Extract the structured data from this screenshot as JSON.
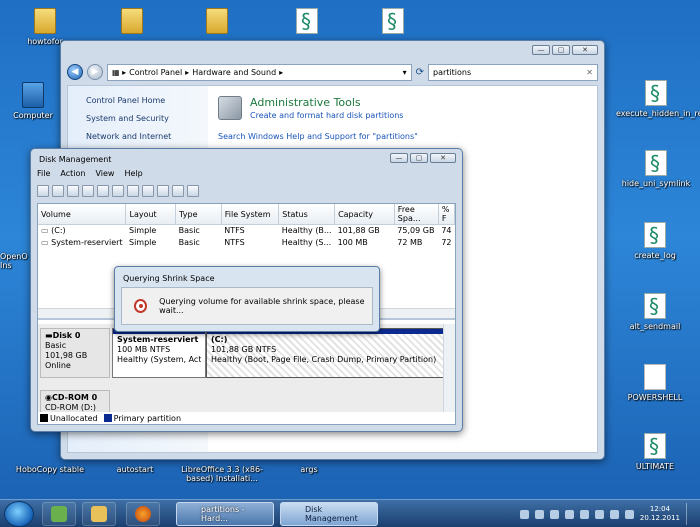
{
  "desktop": {
    "icons": [
      {
        "label": "howtofor",
        "type": "folder"
      },
      {
        "label": "",
        "type": "folder"
      },
      {
        "label": "",
        "type": "folder"
      },
      {
        "label": "",
        "type": "script"
      },
      {
        "label": "",
        "type": "script"
      },
      {
        "label": "Computer",
        "type": "computer"
      },
      {
        "label": "execute_hidden_in_reg",
        "type": "script"
      },
      {
        "label": "hide_uni_symlink",
        "type": "script"
      },
      {
        "label": "create_log",
        "type": "script"
      },
      {
        "label": "alt_sendmail",
        "type": "script"
      },
      {
        "label": "POWERSHELL",
        "type": "doc"
      },
      {
        "label": "ULTIMATE",
        "type": "script"
      },
      {
        "label": "HoboCopy stable",
        "type": "app"
      },
      {
        "label": "autostart",
        "type": "app"
      },
      {
        "label": "LibreOffice 3.3 (x86-based) Installati...",
        "type": "app"
      },
      {
        "label": "args",
        "type": "script"
      },
      {
        "label": "OpenO Ins",
        "type": "app"
      }
    ]
  },
  "control_panel": {
    "breadcrumb": [
      "Control Panel",
      "Hardware and Sound"
    ],
    "search_value": "partitions",
    "sidebar": [
      "Control Panel Home",
      "System and Security",
      "Network and Internet"
    ],
    "result_title": "Administrative Tools",
    "result_link": "Create and format hard disk partitions",
    "help_link": "Search Windows Help and Support for \"partitions\"",
    "buttons": {
      "minimize": "—",
      "maximize": "▢",
      "close": "✕"
    }
  },
  "disk_management": {
    "title": "Disk Management",
    "menu": [
      "File",
      "Action",
      "View",
      "Help"
    ],
    "columns": [
      "Volume",
      "Layout",
      "Type",
      "File System",
      "Status",
      "Capacity",
      "Free Spa...",
      "% F"
    ],
    "rows": [
      [
        "(C:)",
        "Simple",
        "Basic",
        "NTFS",
        "Healthy (B...",
        "101,88 GB",
        "75,09 GB",
        "74"
      ],
      [
        "System-reserviert",
        "Simple",
        "Basic",
        "NTFS",
        "Healthy (S...",
        "100 MB",
        "72 MB",
        "72"
      ]
    ],
    "disk0": {
      "name": "Disk 0",
      "kind": "Basic",
      "size": "101,98 GB",
      "state": "Online",
      "partitions": [
        {
          "name": "System-reserviert",
          "size": "100 MB NTFS",
          "status": "Healthy (System, Active"
        },
        {
          "name": "(C:)",
          "size": "101,88 GB NTFS",
          "status": "Healthy (Boot, Page File, Crash Dump, Primary Partition)"
        }
      ]
    },
    "cdrom": {
      "name": "CD-ROM 0",
      "label": "CD-ROM (D:)"
    },
    "legend": [
      {
        "label": "Unallocated",
        "color": "#000000"
      },
      {
        "label": "Primary partition",
        "color": "#0b2a8f"
      }
    ],
    "buttons": {
      "minimize": "—",
      "maximize": "▢",
      "close": "✕"
    }
  },
  "dialog": {
    "title": "Querying Shrink Space",
    "message": "Querying volume for available shrink space, please wait..."
  },
  "taskbar": {
    "tasks": [
      {
        "label": "partitions - Hard..."
      },
      {
        "label": "Disk Management"
      }
    ],
    "time": "12:04",
    "date": "20.12.2011"
  }
}
